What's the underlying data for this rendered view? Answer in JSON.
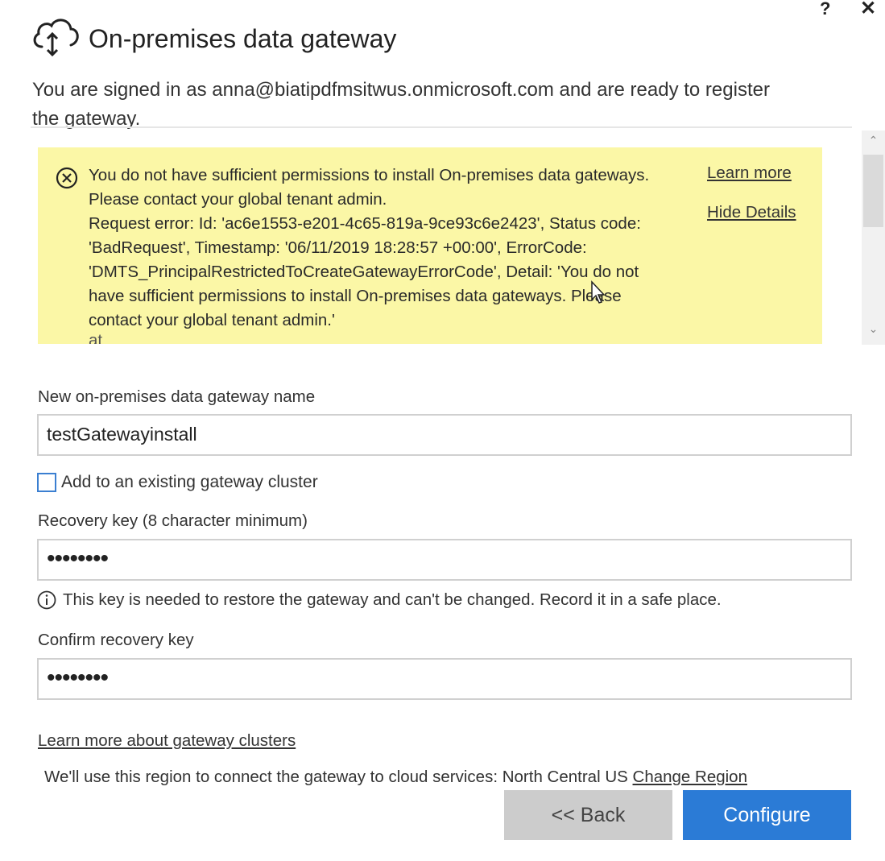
{
  "window": {
    "help_label": "?",
    "close_label": "✕"
  },
  "header": {
    "title": "On-premises data gateway",
    "icon": "cloud-upload-download-icon",
    "signin_message": "You are signed in as anna@biatipdfmsitwus.onmicrosoft.com and are ready to register the gateway."
  },
  "error": {
    "background_color": "#fbf7a6",
    "icon": "error-circle-x-icon",
    "lines": [
      "You do not have sufficient permissions to install On-premises data gateways.",
      "Please contact your global tenant admin.",
      "Request error: Id: 'ac6e1553-e201-4c65-819a-9ce93c6e2423', Status code:",
      "'BadRequest', Timestamp: '06/11/2019 18:28:57 +00:00', ErrorCode:",
      "'DMTS_PrincipalRestrictedToCreateGatewayErrorCode', Detail: 'You do not",
      "have sufficient permissions to install On-premises data gateways. Please",
      "contact your global tenant admin.'"
    ],
    "cut_off_text": "   at",
    "learn_more_label": "Learn more",
    "hide_details_label": "Hide Details"
  },
  "form": {
    "gateway_name_label": "New on-premises data gateway name",
    "gateway_name_value": "testGatewayinstall",
    "add_cluster_label": "Add to an existing gateway cluster",
    "add_cluster_checked": false,
    "recovery_key_label": "Recovery key (8 character minimum)",
    "recovery_key_value": "••••••••",
    "recovery_info": "This key is needed to restore the gateway and can't be changed. Record it in a safe place.",
    "confirm_key_label": "Confirm recovery key",
    "confirm_key_value": "••••••••"
  },
  "footer": {
    "learn_clusters_link": "Learn more about gateway clusters",
    "region_text": "We'll use this region to connect the gateway to cloud services: North Central US",
    "change_region_link": "Change Region",
    "back_label": "<< Back",
    "configure_label": "Configure"
  },
  "colors": {
    "primary_button": "#2b7bd6",
    "secondary_button": "#cccccc",
    "checkbox_border": "#3b7fd1"
  }
}
